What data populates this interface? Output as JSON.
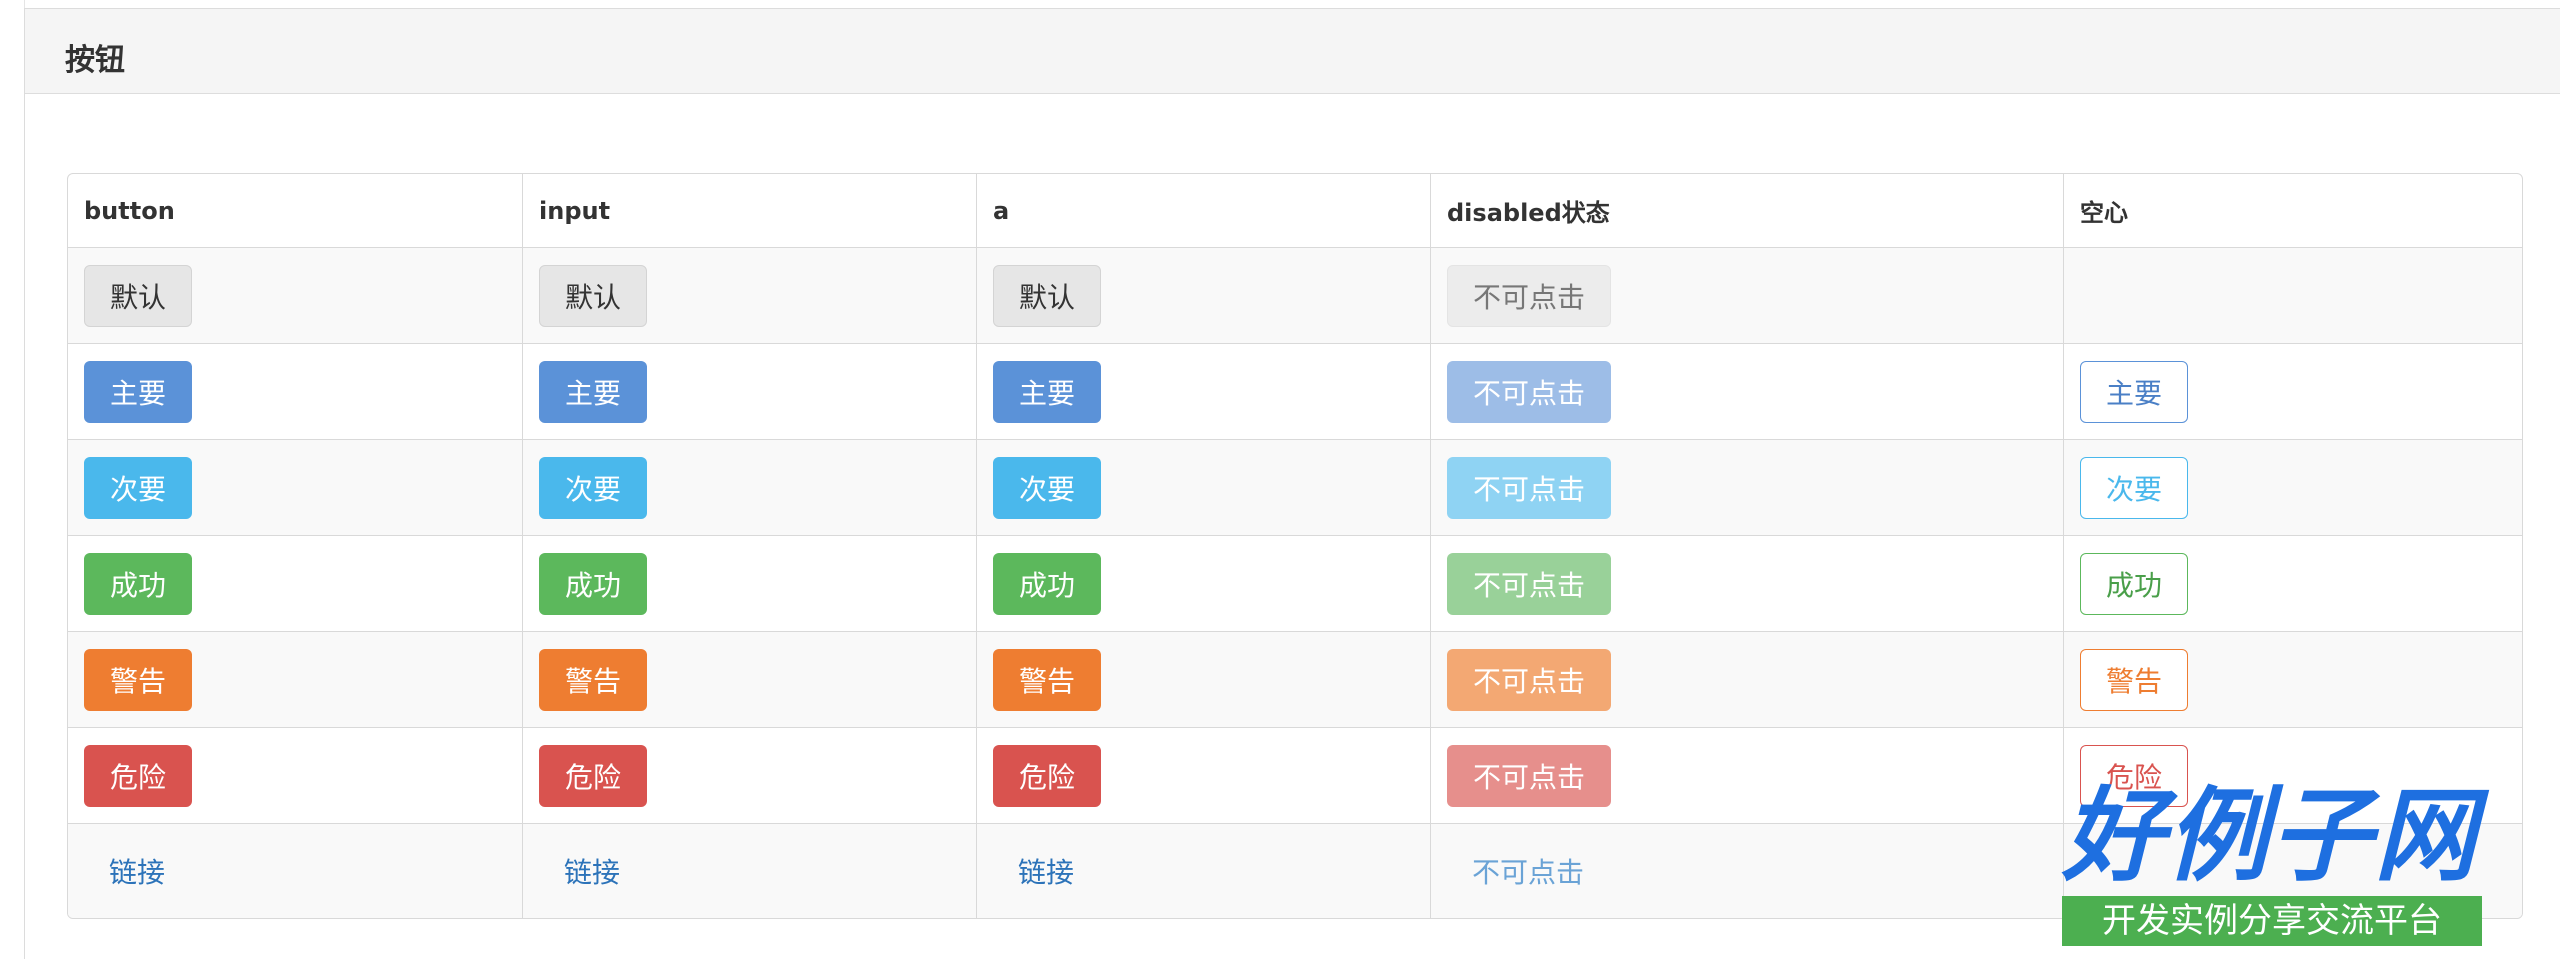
{
  "panel": {
    "title": "按钮"
  },
  "table": {
    "headers": [
      "button",
      "input",
      "a",
      "disabled状态",
      "空心"
    ],
    "rows": [
      {
        "key": "default",
        "label": "默认",
        "outline": ""
      },
      {
        "key": "primary",
        "label": "主要",
        "outline": "主要"
      },
      {
        "key": "info",
        "label": "次要",
        "outline": "次要"
      },
      {
        "key": "success",
        "label": "成功",
        "outline": "成功"
      },
      {
        "key": "warning",
        "label": "警告",
        "outline": "警告"
      },
      {
        "key": "danger",
        "label": "危险",
        "outline": "危险"
      }
    ],
    "link_row": {
      "label": "链接",
      "disabled": "不可点击"
    },
    "disabled_label": "不可点击"
  },
  "watermark": {
    "logo": "好例子网",
    "tagline": "开发实例分享交流平台"
  },
  "colors": {
    "primary": "#5b92d8",
    "info": "#4ab8ec",
    "success": "#5cb85c",
    "warning": "#ee7d31",
    "danger": "#d9534f",
    "link": "#2c73b9"
  }
}
